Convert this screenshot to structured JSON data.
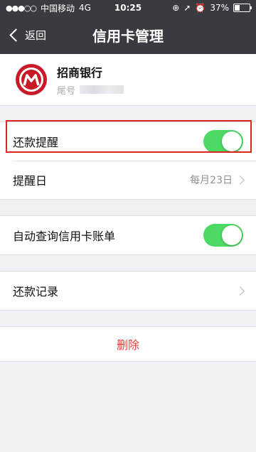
{
  "status_bar": {
    "carrier": "中国移动",
    "network": "4G",
    "time": "10:25",
    "battery_percent": "37%",
    "battery_level": 0.37
  },
  "nav": {
    "back_label": "返回",
    "title": "信用卡管理"
  },
  "bank": {
    "name": "招商银行",
    "tail_label": "尾号",
    "logo_color": "#c91b27"
  },
  "settings": {
    "repay_reminder": {
      "label": "还款提醒",
      "enabled": true
    },
    "reminder_day": {
      "label": "提醒日",
      "value": "每月23日"
    },
    "auto_query": {
      "label": "自动查询信用卡账单",
      "enabled": true
    },
    "repay_records": {
      "label": "还款记录"
    }
  },
  "delete_label": "删除",
  "colors": {
    "toggle_on": "#4cd964",
    "header_bg": "#3a3b40",
    "delete_text": "#e0423a",
    "highlight": "#e02424"
  }
}
